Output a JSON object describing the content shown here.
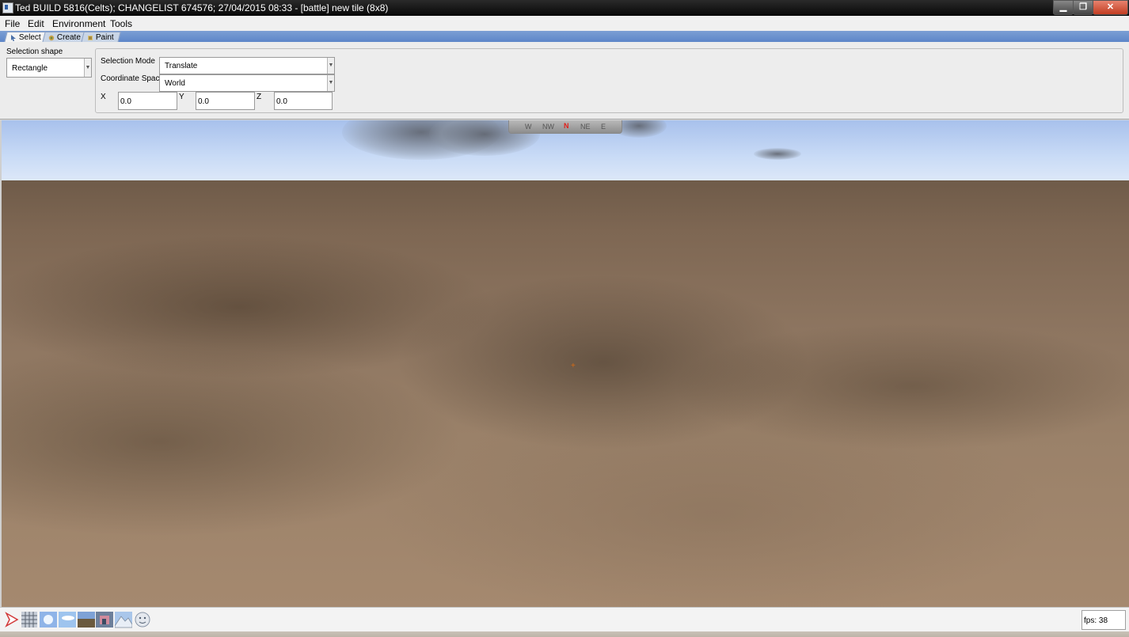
{
  "window": {
    "title": "Ted BUILD 5816(Celts); CHANGELIST 674576; 27/04/2015 08:33 - [battle] new tile (8x8)",
    "minimize_label": "▁",
    "maximize_label": "❐",
    "close_label": "✕"
  },
  "menu": {
    "items": [
      "File",
      "Edit",
      "Environment",
      "Tools"
    ]
  },
  "tabs": [
    {
      "label": "Select",
      "active": true,
      "icon": "select-cursor-icon"
    },
    {
      "label": "Create",
      "active": false,
      "icon": "create-icon"
    },
    {
      "label": "Paint",
      "active": false,
      "icon": "paint-icon"
    }
  ],
  "tool_panel": {
    "selection_shape_label": "Selection shape",
    "selection_shape_value": "Rectangle",
    "selection_mode_label": "Selection Mode",
    "selection_mode_value": "Translate",
    "coordinate_space_label": "Coordinate Space",
    "coordinate_space_value": "World",
    "x_label": "X",
    "x_value": "0.0",
    "y_label": "Y",
    "y_value": "0.0",
    "z_label": "Z",
    "z_value": "0.0"
  },
  "viewport": {
    "compass_marks": [
      "W",
      "NW",
      "N",
      "NE",
      "E"
    ],
    "cursor_glyph": "+"
  },
  "status": {
    "fps_text": "fps: 38",
    "tray_icons": [
      "arrow-icon",
      "grid-icon",
      "sun-icon",
      "sky-icon",
      "terrain-icon",
      "building-icon",
      "mountain-icon",
      "face-icon"
    ]
  },
  "colors": {
    "titlebar": "#0d0d0d",
    "tabstrip": "#6b90cc",
    "close_button": "#c94a2e",
    "compass_north": "#e1201a"
  }
}
